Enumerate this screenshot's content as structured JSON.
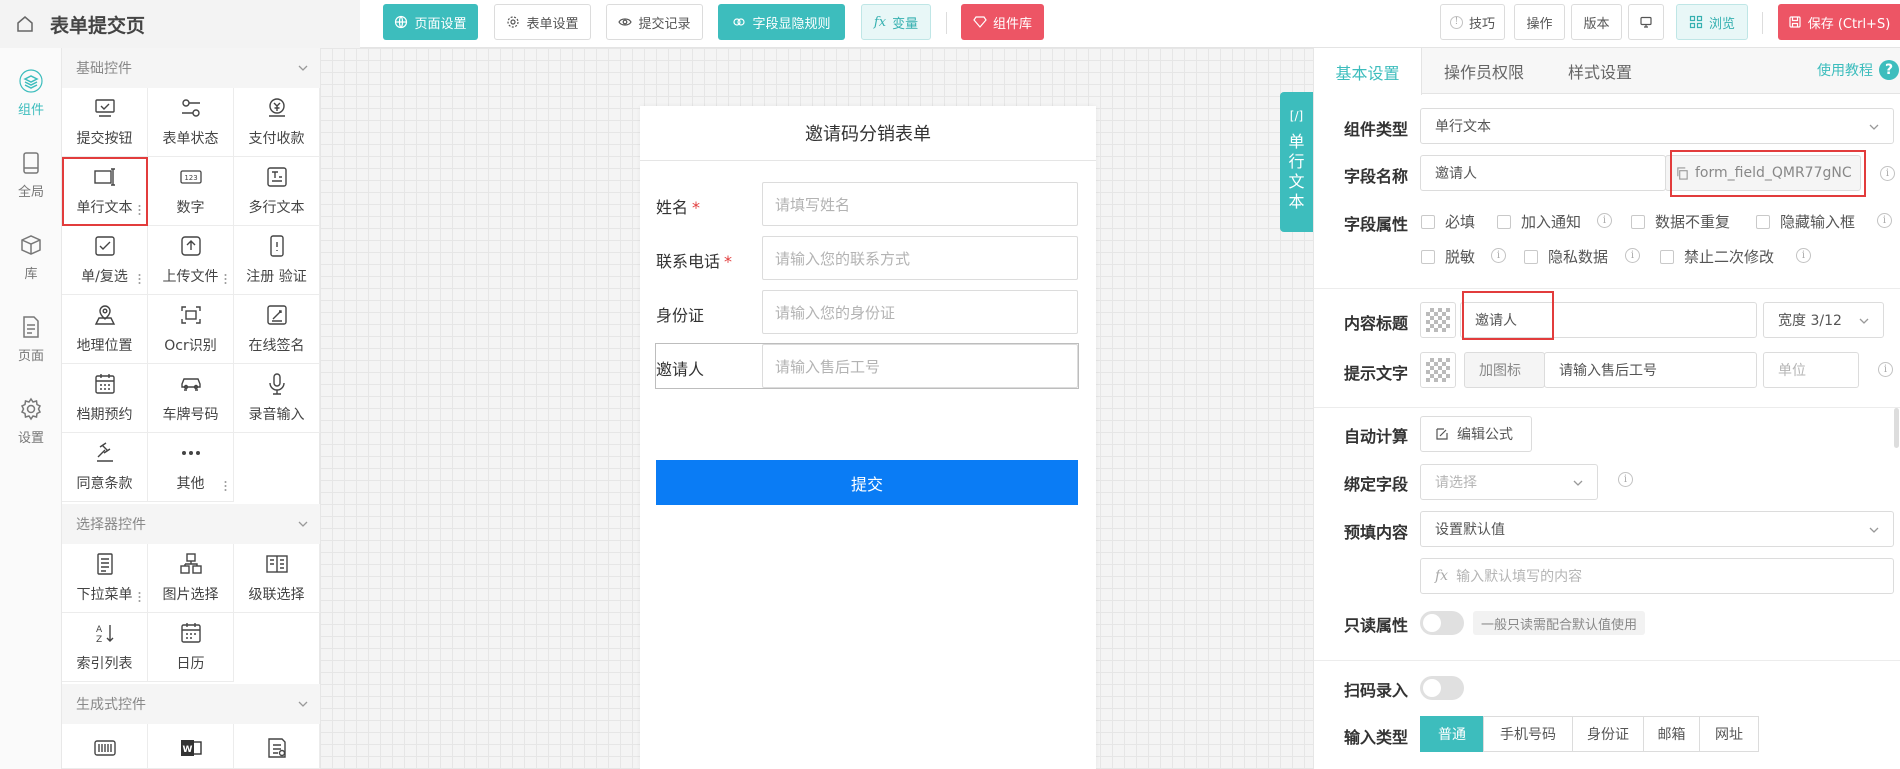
{
  "app": {
    "title": "表单提交页"
  },
  "toolbar": {
    "page_settings": "页面设置",
    "form_settings": "表单设置",
    "submit_records": "提交记录",
    "field_rules": "字段显隐规则",
    "variables": "变量",
    "component_library": "组件库",
    "tips": "技巧",
    "operation": "操作",
    "version": "版本",
    "browse": "浏览",
    "save": "保存 (Ctrl+S)"
  },
  "rail": [
    {
      "label": "组件",
      "icon": "layers-icon",
      "active": true
    },
    {
      "label": "全局",
      "icon": "tablet-icon"
    },
    {
      "label": "库",
      "icon": "box-icon"
    },
    {
      "label": "页面",
      "icon": "document-icon"
    },
    {
      "label": "设置",
      "icon": "gear-icon"
    }
  ],
  "components": {
    "basic": {
      "title": "基础控件",
      "items": [
        {
          "label": "提交按钮",
          "icon": "submit-button-icon"
        },
        {
          "label": "表单状态",
          "icon": "form-status-icon"
        },
        {
          "label": "支付收款",
          "icon": "payment-icon"
        },
        {
          "label": "单行文本",
          "icon": "single-line-text-icon",
          "selected": true,
          "dots": true
        },
        {
          "label": "数字",
          "icon": "number-icon"
        },
        {
          "label": "多行文本",
          "icon": "multi-line-text-icon"
        },
        {
          "label": "单/复选",
          "icon": "checkbox-icon",
          "dots": true
        },
        {
          "label": "上传文件",
          "icon": "upload-icon",
          "dots": true
        },
        {
          "label": "注册 验证",
          "icon": "phone-verify-icon"
        },
        {
          "label": "地理位置",
          "icon": "location-icon"
        },
        {
          "label": "Ocr识别",
          "icon": "ocr-icon"
        },
        {
          "label": "在线签名",
          "icon": "signature-icon"
        },
        {
          "label": "档期预约",
          "icon": "calendar-grid-icon"
        },
        {
          "label": "车牌号码",
          "icon": "car-icon"
        },
        {
          "label": "录音输入",
          "icon": "microphone-icon"
        },
        {
          "label": "同意条款",
          "icon": "gavel-icon"
        },
        {
          "label": "其他",
          "icon": "more-icon",
          "dots": true
        }
      ]
    },
    "selector": {
      "title": "选择器控件",
      "items": [
        {
          "label": "下拉菜单",
          "icon": "dropdown-icon",
          "dots": true
        },
        {
          "label": "图片选择",
          "icon": "image-select-icon"
        },
        {
          "label": "级联选择",
          "icon": "cascade-icon"
        },
        {
          "label": "索引列表",
          "icon": "sort-az-icon"
        },
        {
          "label": "日历",
          "icon": "calendar-icon"
        }
      ]
    },
    "generated": {
      "title": "生成式控件",
      "items": [
        {
          "label": "",
          "icon": "barcode-icon"
        },
        {
          "label": "",
          "icon": "word-doc-icon"
        },
        {
          "label": "",
          "icon": "report-icon"
        }
      ]
    }
  },
  "form": {
    "title": "邀请码分销表单",
    "fields": [
      {
        "label": "姓名",
        "required": true,
        "placeholder": "请填写姓名"
      },
      {
        "label": "联系电话",
        "required": true,
        "placeholder": "请输入您的联系方式"
      },
      {
        "label": "身份证",
        "required": false,
        "placeholder": "请输入您的身份证"
      },
      {
        "label": "邀请人",
        "required": false,
        "placeholder": "请输入售后工号",
        "active": true
      }
    ],
    "submit": "提交"
  },
  "side_tab": {
    "code": "[/]",
    "chars": [
      "单",
      "行",
      "文",
      "本"
    ]
  },
  "props": {
    "tabs": [
      "基本设置",
      "操作员权限",
      "样式设置"
    ],
    "help": "使用教程",
    "component_type": {
      "label": "组件类型",
      "value": "单行文本"
    },
    "field_name": {
      "label": "字段名称",
      "value": "邀请人",
      "key": "form_field_QMR77gNC"
    },
    "field_attrs": {
      "label": "字段属性",
      "row1": [
        "必填",
        "加入通知",
        "数据不重复",
        "隐藏输入框"
      ],
      "row2": [
        "脱敏",
        "隐私数据",
        "禁止二次修改"
      ]
    },
    "content_title": {
      "label": "内容标题",
      "value": "邀请人",
      "width": "宽度 3/12"
    },
    "hint_text": {
      "label": "提示文字",
      "add_icon": "加图标",
      "value": "请输入售后工号",
      "unit_placeholder": "单位"
    },
    "auto_calc": {
      "label": "自动计算",
      "button": "编辑公式"
    },
    "bind_field": {
      "label": "绑定字段",
      "placeholder": "请选择"
    },
    "prefill": {
      "label": "预填内容",
      "value": "设置默认值",
      "input_placeholder": "输入默认填写的内容"
    },
    "readonly": {
      "label": "只读属性",
      "hint": "一般只读需配合默认值使用"
    },
    "scan": {
      "label": "扫码录入"
    },
    "input_type": {
      "label": "输入类型",
      "options": [
        "普通",
        "手机号码",
        "身份证",
        "邮箱",
        "网址"
      ],
      "selected": "普通"
    }
  }
}
